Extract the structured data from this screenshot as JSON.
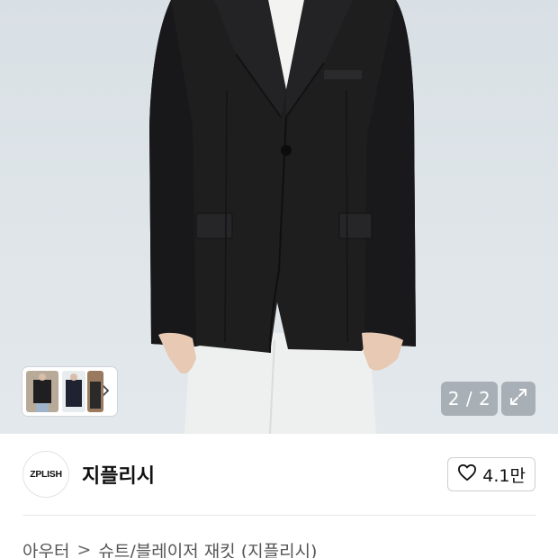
{
  "product_gallery": {
    "counter": "2 / 2",
    "icons": {
      "thumbnail_next": "chevron-right-icon",
      "expand": "expand-arrows-icon"
    }
  },
  "brand": {
    "logo_text": "ZPLISH",
    "name": "지플리시",
    "like_count": "4.1만",
    "like_icon": "heart-outline-icon"
  },
  "breadcrumb": {
    "category": "아우터",
    "separator": ">",
    "subcategory": "슈트/블레이저 재킷 (지플리시)"
  },
  "colors": {
    "background": "#ffffff",
    "photo_background": "#dde3e8",
    "counter_overlay": "#78828a",
    "text_primary": "#111111",
    "text_secondary": "#555555"
  }
}
